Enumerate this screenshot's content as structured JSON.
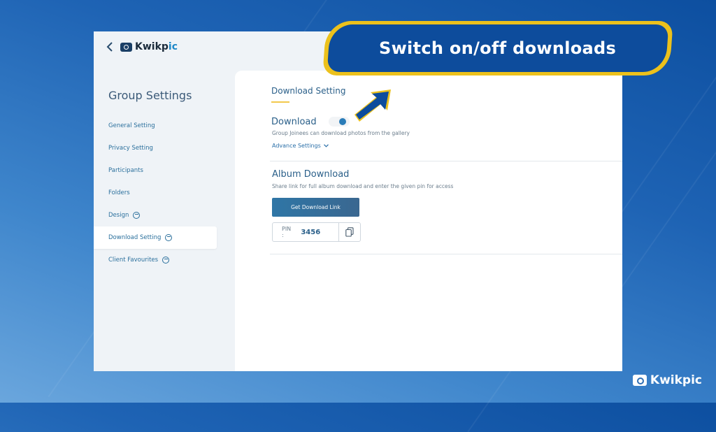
{
  "app": {
    "logo_text_a": "Kwikp",
    "logo_text_b": "ic",
    "back_icon": "chevron-left-icon"
  },
  "sidebar": {
    "title": "Group Settings",
    "items": [
      {
        "label": "General Setting",
        "premium": false,
        "active": false
      },
      {
        "label": "Privacy Setting",
        "premium": false,
        "active": false
      },
      {
        "label": "Participants",
        "premium": false,
        "active": false
      },
      {
        "label": "Folders",
        "premium": false,
        "active": false
      },
      {
        "label": "Design",
        "premium": true,
        "active": false
      },
      {
        "label": "Download Setting",
        "premium": true,
        "active": true
      },
      {
        "label": "Client Favourites",
        "premium": true,
        "active": false
      }
    ]
  },
  "main": {
    "section_title": "Download Setting",
    "download_label": "Download",
    "download_toggle_on": true,
    "download_desc": "Group Joinees can download photos from the gallery",
    "advance_settings": "Advance Settings",
    "album_title": "Album Download",
    "album_desc": "Share link for full album download and enter the given pin for access",
    "get_link_button": "Get Download Link",
    "pin_label": "PIN :",
    "pin_value": "3456"
  },
  "overlay": {
    "callout": "Switch on/off downloads",
    "brand": "Kwikpic"
  },
  "colors": {
    "accent": "#2a7cb8",
    "callout_bg": "#0d4c9c",
    "callout_border": "#ecc11c",
    "heading": "#2a5f89"
  }
}
